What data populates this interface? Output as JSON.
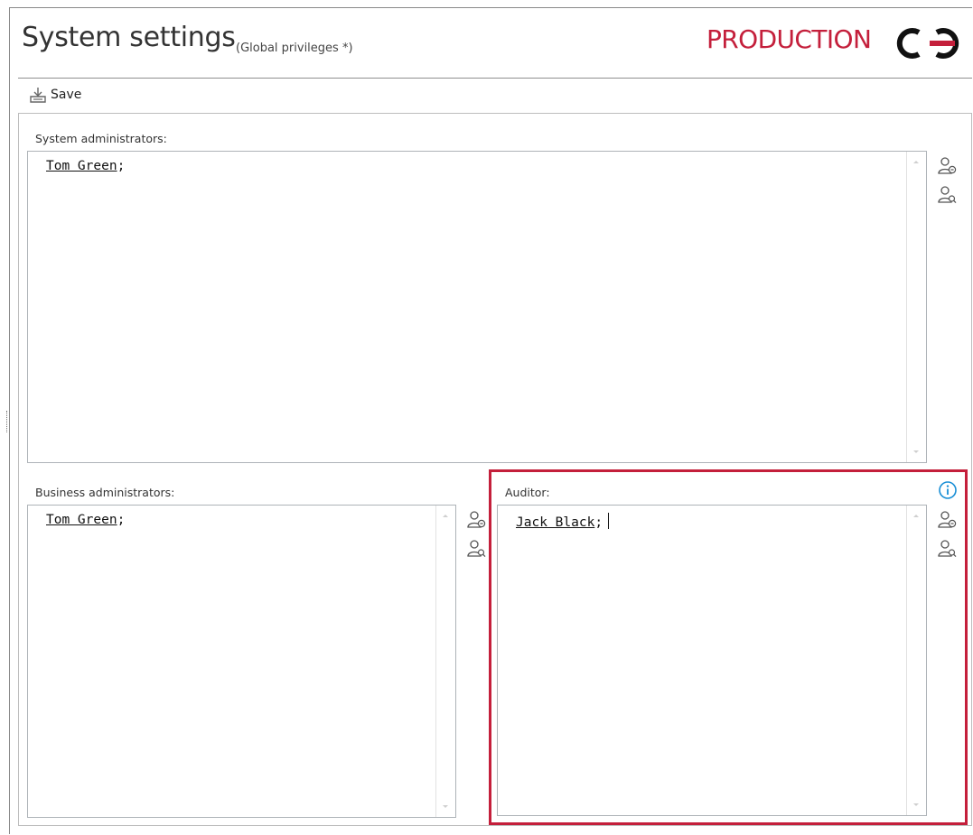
{
  "header": {
    "title": "System settings",
    "subtitle": "(Global privileges *)",
    "environment_label": "PRODUCTION",
    "logo_icon": "production-logo-icon"
  },
  "toolbar": {
    "save_label": "Save",
    "save_icon": "save-icon"
  },
  "fields": {
    "system_administrators": {
      "label": "System administrators:",
      "users": [
        "Tom Green"
      ],
      "separator": ";"
    },
    "business_administrators": {
      "label": "Business administrators:",
      "users": [
        "Tom Green"
      ],
      "separator": ";"
    },
    "auditor": {
      "label": "Auditor:",
      "users": [
        "Jack Black"
      ],
      "separator": ";"
    }
  },
  "icons": {
    "select_user": "select-user-icon",
    "search_user": "search-user-icon",
    "info": "info-icon"
  },
  "colors": {
    "brand_red": "#c41f3b",
    "info_blue": "#1a8fd6",
    "icon_gray": "#555555"
  }
}
